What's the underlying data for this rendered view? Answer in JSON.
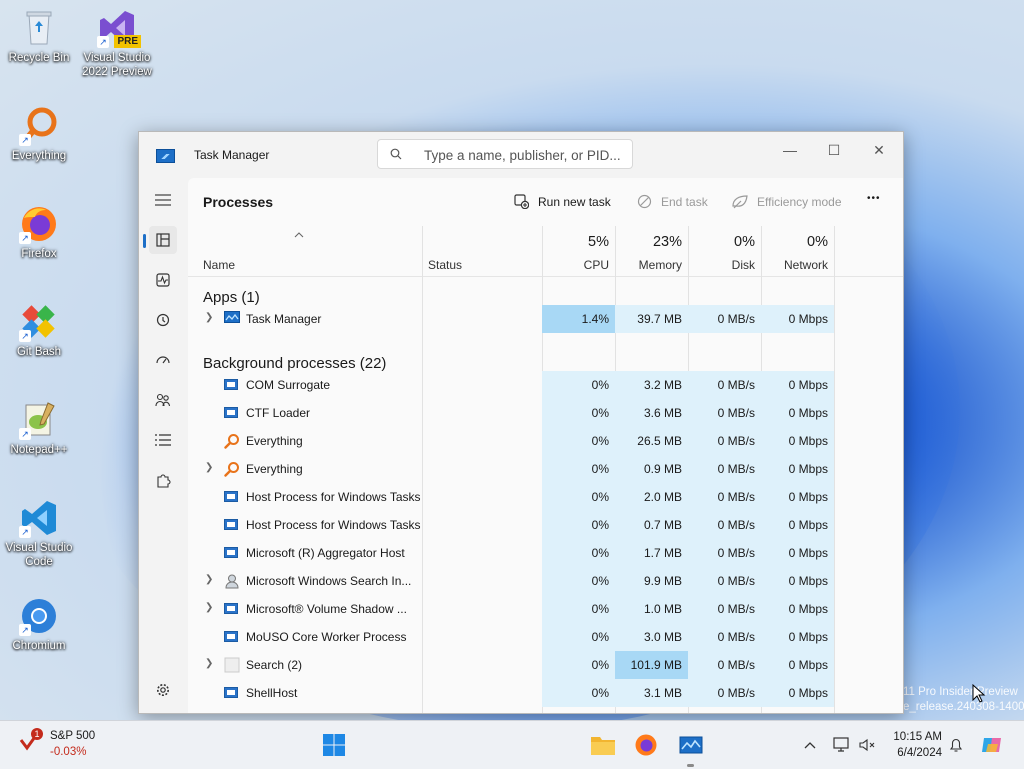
{
  "desktop": {
    "icons": [
      {
        "label": "Recycle Bin"
      },
      {
        "label": "Visual Studio 2022 Preview",
        "badge": "PRE"
      },
      {
        "label": "Everything"
      },
      {
        "label": "Firefox"
      },
      {
        "label": "Git Bash"
      },
      {
        "label": "Notepad++"
      },
      {
        "label": "Visual Studio Code"
      },
      {
        "label": "Chromium"
      }
    ],
    "watermark_line1": "11 Pro Insider Preview",
    "watermark_line2": "e_release.240308-1400"
  },
  "window": {
    "title": "Task Manager",
    "search_placeholder": "Type a name, publisher, or PID...",
    "min": "—",
    "max": "☐",
    "close": "✕"
  },
  "toolbar": {
    "title": "Processes",
    "run_new_task": "Run new task",
    "end_task": "End task",
    "efficiency_mode": "Efficiency mode",
    "more": "•••"
  },
  "columns": {
    "name": "Name",
    "status": "Status",
    "cpu_pct": "5%",
    "cpu": "CPU",
    "mem_pct": "23%",
    "mem": "Memory",
    "disk_pct": "0%",
    "disk": "Disk",
    "net_pct": "0%",
    "net": "Network"
  },
  "groups": {
    "apps": "Apps (1)",
    "background": "Background processes (22)"
  },
  "apps": [
    {
      "name": "Task Manager",
      "cpu": "1.4%",
      "mem": "39.7 MB",
      "disk": "0 MB/s",
      "net": "0 Mbps",
      "expandable": true
    }
  ],
  "background": [
    {
      "name": "COM Surrogate",
      "cpu": "0%",
      "mem": "3.2 MB",
      "disk": "0 MB/s",
      "net": "0 Mbps"
    },
    {
      "name": "CTF Loader",
      "cpu": "0%",
      "mem": "3.6 MB",
      "disk": "0 MB/s",
      "net": "0 Mbps"
    },
    {
      "name": "Everything",
      "cpu": "0%",
      "mem": "26.5 MB",
      "disk": "0 MB/s",
      "net": "0 Mbps"
    },
    {
      "name": "Everything",
      "cpu": "0%",
      "mem": "0.9 MB",
      "disk": "0 MB/s",
      "net": "0 Mbps"
    },
    {
      "name": "Host Process for Windows Tasks",
      "cpu": "0%",
      "mem": "2.0 MB",
      "disk": "0 MB/s",
      "net": "0 Mbps"
    },
    {
      "name": "Host Process for Windows Tasks",
      "cpu": "0%",
      "mem": "0.7 MB",
      "disk": "0 MB/s",
      "net": "0 Mbps"
    },
    {
      "name": "Microsoft (R) Aggregator Host",
      "cpu": "0%",
      "mem": "1.7 MB",
      "disk": "0 MB/s",
      "net": "0 Mbps"
    },
    {
      "name": "Microsoft Windows Search In...",
      "cpu": "0%",
      "mem": "9.9 MB",
      "disk": "0 MB/s",
      "net": "0 Mbps"
    },
    {
      "name": "Microsoft® Volume Shadow ...",
      "cpu": "0%",
      "mem": "1.0 MB",
      "disk": "0 MB/s",
      "net": "0 Mbps"
    },
    {
      "name": "MoUSO Core Worker Process",
      "cpu": "0%",
      "mem": "3.0 MB",
      "disk": "0 MB/s",
      "net": "0 Mbps"
    },
    {
      "name": "Search (2)",
      "cpu": "0%",
      "mem": "101.9 MB",
      "disk": "0 MB/s",
      "net": "0 Mbps"
    },
    {
      "name": "ShellHost",
      "cpu": "0%",
      "mem": "3.1 MB",
      "disk": "0 MB/s",
      "net": "0 Mbps"
    }
  ],
  "taskbar": {
    "stock_name": "S&P 500",
    "stock_change": "-0.03%",
    "stock_badge": "1",
    "time": "10:15 AM",
    "date": "6/4/2024"
  },
  "colors": {
    "accent": "#1d6fc7",
    "cell_light": "#def1fb",
    "cell_mid": "#a8d8f5",
    "stock_down": "#c42b1c"
  }
}
